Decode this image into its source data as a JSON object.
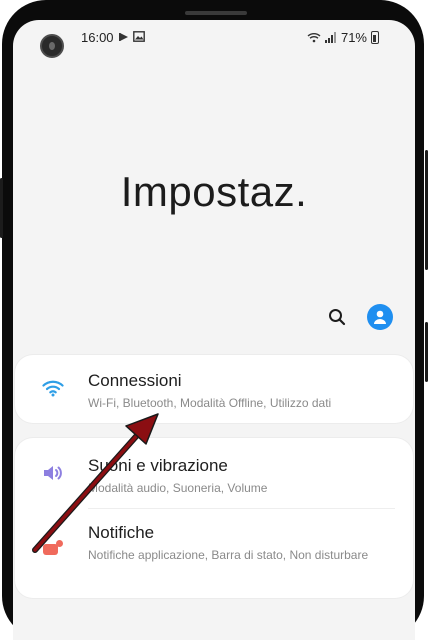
{
  "status_bar": {
    "time": "16:00",
    "battery": "71%",
    "icons_left": [
      "play-icon",
      "gallery-icon"
    ],
    "icons_right": [
      "wifi-icon",
      "signal-icon",
      "battery-icon"
    ]
  },
  "header": {
    "title": "Impostaz."
  },
  "actions": {
    "search_icon": "search-icon",
    "profile_icon": "profile-avatar-icon"
  },
  "settings": [
    {
      "label": "Connessioni",
      "subtitle": "Wi-Fi, Bluetooth, Modalità Offline, Utilizzo dati",
      "icon": "wifi-icon",
      "icon_color": "#2e9ee6"
    },
    {
      "label": "Suoni e vibrazione",
      "subtitle": "Modalità audio, Suoneria, Volume",
      "icon": "volume-icon",
      "icon_color": "#8d7fe0"
    },
    {
      "label": "Notifiche",
      "subtitle": "Notifiche applicazione, Barra di stato, Non disturbare",
      "icon": "notification-icon",
      "icon_color": "#f06a5c"
    }
  ],
  "colors": {
    "accent": "#1f8ff0",
    "annotation_arrow": "#8b0e12"
  }
}
